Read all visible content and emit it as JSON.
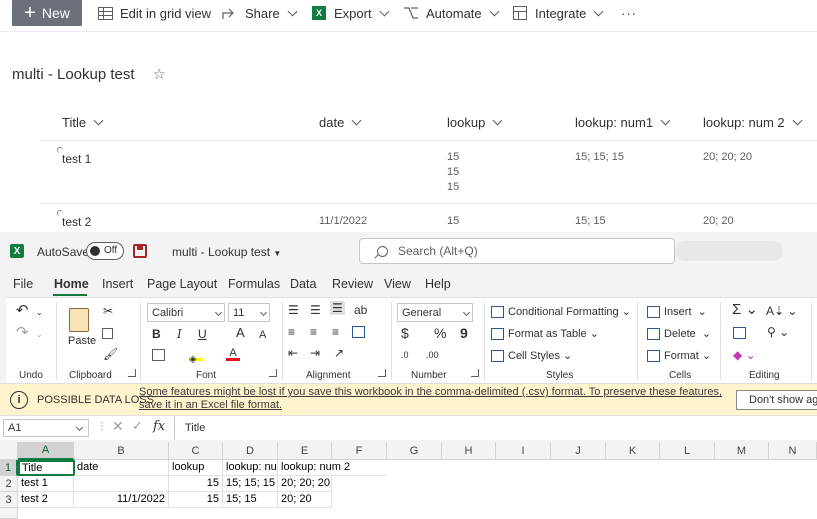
{
  "sharepoint": {
    "toolbar": {
      "new": "New",
      "edit_grid": "Edit in grid view",
      "share": "Share",
      "export": "Export",
      "automate": "Automate",
      "integrate": "Integrate",
      "more": "···"
    },
    "list_title": "multi - Lookup test",
    "columns": [
      "Title",
      "date",
      "lookup",
      "lookup: num1",
      "lookup: num 2"
    ],
    "rows": [
      {
        "title": "test 1",
        "date": "",
        "lookup": [
          "15",
          "15",
          "15"
        ],
        "num1": "15; 15; 15",
        "num2": "20; 20; 20"
      },
      {
        "title": "test 2",
        "date": "11/1/2022",
        "lookup": [
          "15"
        ],
        "num1": "15; 15",
        "num2": "20; 20"
      }
    ]
  },
  "excel": {
    "autosave_label": "AutoSave",
    "autosave_state": "Off",
    "doc_name": "multi - Lookup test",
    "search_placeholder": "Search (Alt+Q)",
    "menu": [
      "File",
      "Home",
      "Insert",
      "Page Layout",
      "Formulas",
      "Data",
      "Review",
      "View",
      "Help"
    ],
    "ribbon": {
      "groups": [
        "Undo",
        "Clipboard",
        "Font",
        "Alignment",
        "Number",
        "Styles",
        "Cells",
        "Editing"
      ],
      "paste": "Paste",
      "font_name": "Calibri",
      "font_size": "11",
      "number_format": "General",
      "bold": "B",
      "italic": "I",
      "underline": "U",
      "grow": "A",
      "shrink": "A",
      "currency": "$",
      "percent": "%",
      "comma": "9",
      "conditional_formatting": "Conditional Formatting",
      "format_as_table": "Format as Table",
      "cell_styles": "Cell Styles",
      "insert": "Insert",
      "delete": "Delete",
      "format": "Format"
    },
    "warning": {
      "title": "POSSIBLE DATA LOSS",
      "message": "Some features might be lost if you save this workbook in the comma-delimited (.csv) format. To preserve these features, save it in an Excel file format.",
      "dismiss": "Don't show aga"
    },
    "formula_bar": {
      "name_box": "A1",
      "fx": "fx",
      "value": "Title"
    },
    "grid": {
      "columns": [
        "A",
        "B",
        "C",
        "D",
        "E",
        "F",
        "G",
        "H",
        "I",
        "J",
        "K",
        "L",
        "M",
        "N"
      ],
      "row_numbers": [
        "1",
        "2",
        "3"
      ],
      "cells": [
        [
          "Title",
          "date",
          "lookup",
          "lookup: nu",
          "lookup: num 2"
        ],
        [
          "test 1",
          "",
          "15",
          "15; 15; 15",
          "20; 20; 20"
        ],
        [
          "test 2",
          "11/1/2022",
          "15",
          "15; 15",
          "20; 20"
        ]
      ]
    },
    "colors": {
      "brand_green": "#107c41",
      "warning_bg": "#fff4ce"
    }
  }
}
